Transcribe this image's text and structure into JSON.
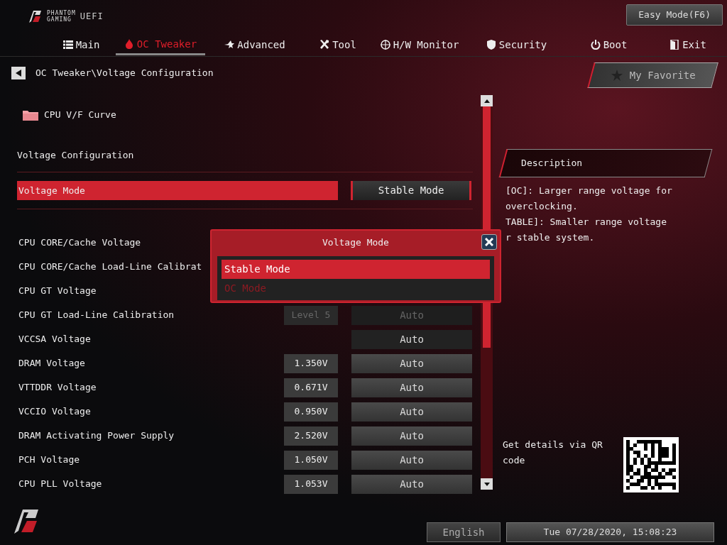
{
  "header": {
    "brand_line_1": "PHANTOM",
    "brand_line_2": "GAMING",
    "brand_uefi": "UEFI",
    "easy_mode_button": "Easy Mode(F6)"
  },
  "tabs": [
    {
      "label": "Main",
      "selected": false
    },
    {
      "label": "OC Tweaker",
      "selected": true
    },
    {
      "label": "Advanced",
      "selected": false
    },
    {
      "label": "Tool",
      "selected": false
    },
    {
      "label": "H/W Monitor",
      "selected": false
    },
    {
      "label": "Security",
      "selected": false
    },
    {
      "label": "Boot",
      "selected": false
    },
    {
      "label": "Exit",
      "selected": false
    }
  ],
  "breadcrumb": "OC Tweaker\\Voltage Configuration",
  "folder_item": "CPU V/F Curve",
  "section_title": "Voltage Configuration",
  "selected_setting": {
    "label": "Voltage Mode",
    "value": "Stable Mode"
  },
  "settings": [
    {
      "label": "CPU CORE/Cache Voltage"
    },
    {
      "label": "CPU CORE/Cache Load-Line Calibrat"
    },
    {
      "label": "CPU GT Voltage"
    },
    {
      "label": "CPU GT Load-Line Calibration",
      "reading": "Level 5",
      "option": "Auto",
      "dimmed": true
    },
    {
      "label": "VCCSA Voltage",
      "option": "Auto",
      "dimmed": false
    },
    {
      "label": "DRAM Voltage",
      "reading": "1.350V",
      "option": "Auto",
      "dimmed": false
    },
    {
      "label": "VTTDDR Voltage",
      "reading": "0.671V",
      "option": "Auto",
      "dimmed": false
    },
    {
      "label": "VCCIO Voltage",
      "reading": "0.950V",
      "option": "Auto",
      "dimmed": false
    },
    {
      "label": "DRAM Activating Power Supply",
      "reading": "2.520V",
      "option": "Auto",
      "dimmed": false
    },
    {
      "label": "PCH Voltage",
      "reading": "1.050V",
      "option": "Auto",
      "dimmed": false
    },
    {
      "label": "CPU PLL Voltage",
      "reading": "1.053V",
      "option": "Auto",
      "dimmed": false
    }
  ],
  "dialog": {
    "title": "Voltage Mode",
    "options": [
      {
        "label": "Stable Mode",
        "selected": true
      },
      {
        "label": "OC Mode",
        "selected": false
      }
    ]
  },
  "favorite_button": "My Favorite",
  "description": {
    "title": "Description",
    "lines": [
      "[OC]: Larger range voltage for overclocking.",
      "TABLE]: Smaller range voltage",
      "r stable system."
    ]
  },
  "qr": {
    "text": "Get details via QR code"
  },
  "footer": {
    "language": "English",
    "datetime": "Tue 07/28/2020, 15:08:23"
  }
}
